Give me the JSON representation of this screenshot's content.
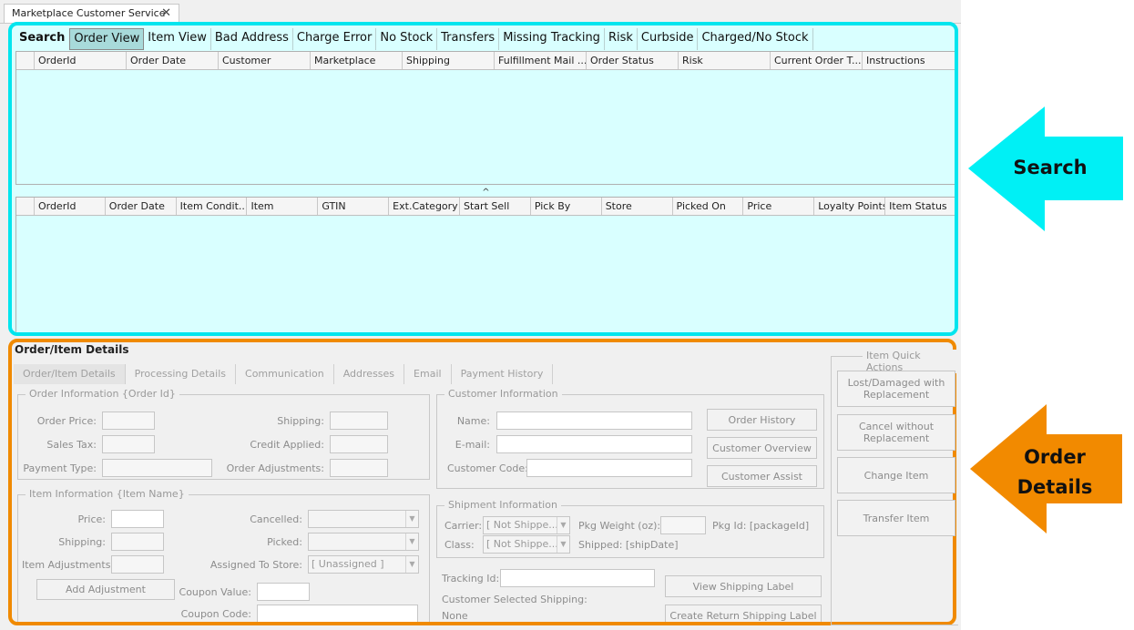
{
  "window": {
    "tab_title": "Marketplace Customer Service",
    "close_glyph": "✕"
  },
  "search": {
    "label": "Search",
    "tabs": [
      "Order View",
      "Item View",
      "Bad Address",
      "Charge Error",
      "No Stock",
      "Transfers",
      "Missing Tracking",
      "Risk",
      "Curbside",
      "Charged/No Stock"
    ],
    "active_tab": "Order View",
    "orders_columns": [
      "OrderId",
      "Order Date",
      "Customer",
      "Marketplace",
      "Shipping",
      "Fulfillment Mail ...",
      "Order Status",
      "Risk",
      "Current Order T...",
      "Instructions"
    ],
    "items_columns": [
      "OrderId",
      "Order Date",
      "Item Condit...",
      "Item",
      "GTIN",
      "Ext.Category",
      "Start Sell",
      "Pick By",
      "Store",
      "Picked On",
      "Price",
      "Loyalty Points",
      "Item Status"
    ],
    "splitter_glyph": "^"
  },
  "details": {
    "title": "Order/Item Details",
    "tabs": [
      "Order/Item Details",
      "Processing Details",
      "Communication",
      "Addresses",
      "Email",
      "Payment History"
    ],
    "order_info": {
      "title": "Order Information {Order Id}",
      "order_price": "Order Price:",
      "sales_tax": "Sales Tax:",
      "payment_type": "Payment Type:",
      "shipping": "Shipping:",
      "credit_applied": "Credit Applied:",
      "order_adjustments": "Order Adjustments:"
    },
    "customer_info": {
      "title": "Customer Information",
      "name": "Name:",
      "email": "E-mail:",
      "customer_code": "Customer Code:",
      "order_history": "Order History",
      "customer_overview": "Customer Overview",
      "customer_assist": "Customer Assist"
    },
    "item_info": {
      "title": "Item Information {Item Name}",
      "price": "Price:",
      "shipping": "Shipping:",
      "item_adjustments": "Item Adjustments:",
      "cancelled": "Cancelled:",
      "picked": "Picked:",
      "assigned_to_store": "Assigned To Store:",
      "assigned_value": "[ Unassigned ]",
      "add_adjustment": "Add Adjustment",
      "coupon_value": "Coupon Value:",
      "coupon_code": "Coupon Code:"
    },
    "shipment_info": {
      "title": "Shipment Information",
      "carrier": "Carrier:",
      "carrier_value": "[ Not Shippe...",
      "class": "Class:",
      "class_value": "[ Not Shippe...",
      "pkg_weight": "Pkg Weight (oz):",
      "pkg_id": "Pkg Id: [packageId]",
      "shipped": "Shipped: [shipDate]",
      "tracking_id": "Tracking Id:",
      "view_label": "View Shipping Label",
      "customer_selected_shipping": "Customer Selected Shipping:",
      "selected_value": "None",
      "create_return_label": "Create Return Shipping Label"
    },
    "quick_actions": {
      "title": "Item Quick Actions",
      "lost_damaged": "Lost/Damaged with Replacement",
      "cancel_without": "Cancel without Replacement",
      "change_item": "Change Item",
      "transfer_item": "Transfer Item"
    }
  },
  "callouts": {
    "search": "Search",
    "order_details_1": "Order",
    "order_details_2": "Details"
  },
  "colors": {
    "search_highlight": "#00e5ee",
    "search_fill": "#d9ffff",
    "details_highlight": "#f08a00"
  }
}
